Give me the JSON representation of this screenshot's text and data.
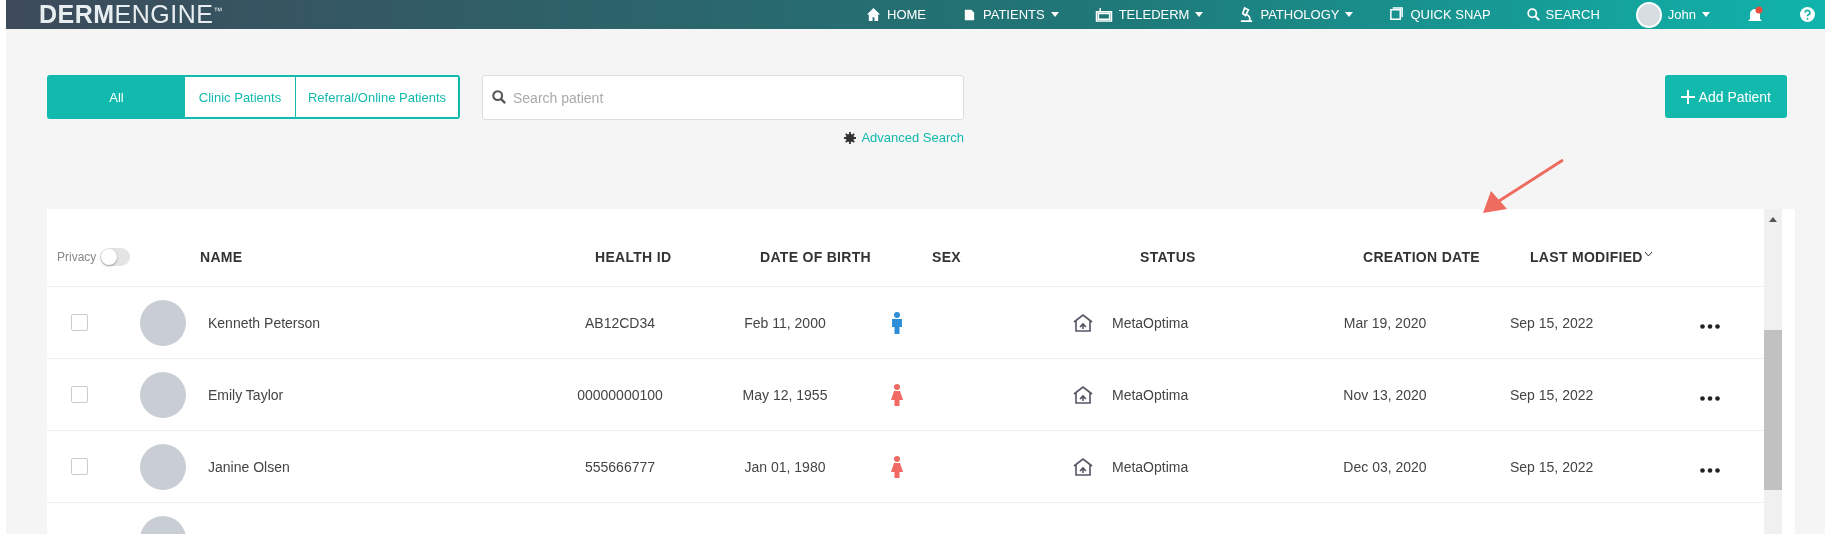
{
  "navbar": {
    "logo_bold": "DERM",
    "logo_light": "ENGINE",
    "logo_mark": "™",
    "items": [
      {
        "kind": "home",
        "label": "HOME",
        "dropdown": false
      },
      {
        "kind": "patients",
        "label": "PATIENTS",
        "dropdown": true
      },
      {
        "kind": "telederm",
        "label": "TELEDERM",
        "dropdown": true
      },
      {
        "kind": "pathology",
        "label": "PATHOLOGY",
        "dropdown": true
      },
      {
        "kind": "snap",
        "label": "QUICK SNAP",
        "dropdown": false
      },
      {
        "kind": "search",
        "label": "SEARCH",
        "dropdown": false
      }
    ],
    "user": {
      "name": "John",
      "dropdown": true
    },
    "notifications": {
      "unread": true
    }
  },
  "filter_tabs": [
    {
      "label": "All",
      "selected": true
    },
    {
      "label": "Clinic Patients",
      "selected": false
    },
    {
      "label": "Referral/Online Patients",
      "selected": false
    }
  ],
  "search": {
    "placeholder": "Search patient"
  },
  "advanced_search": "Advanced Search",
  "add_button": "Add Patient",
  "table": {
    "privacy": {
      "label": "Privacy",
      "on": false
    },
    "columns": [
      {
        "label": "NAME",
        "sorted": false
      },
      {
        "label": "HEALTH ID",
        "sorted": false
      },
      {
        "label": "DATE OF BIRTH",
        "sorted": false
      },
      {
        "label": "SEX",
        "sorted": false
      },
      {
        "label": "STATUS",
        "sorted": false
      },
      {
        "label": "CREATION DATE",
        "sorted": false
      },
      {
        "label": "LAST MODIFIED",
        "sorted": true
      }
    ],
    "rows": [
      {
        "checked": false,
        "name": "Kenneth Peterson",
        "health_id": "AB12CD34",
        "dob": "Feb 11, 2000",
        "sex": {
          "kind": "male"
        },
        "status": "MetaOptima",
        "created": "Mar 19, 2020",
        "modified": "Sep 15, 2022"
      },
      {
        "checked": false,
        "name": "Emily Taylor",
        "health_id": "00000000100",
        "dob": "May 12, 1955",
        "sex": {
          "kind": "female"
        },
        "status": "MetaOptima",
        "created": "Nov 13, 2020",
        "modified": "Sep 15, 2022"
      },
      {
        "checked": false,
        "name": "Janine Olsen",
        "health_id": "555666777",
        "dob": "Jan 01, 1980",
        "sex": {
          "kind": "female"
        },
        "status": "MetaOptima",
        "created": "Dec 03, 2020",
        "modified": "Sep 15, 2022"
      }
    ]
  }
}
